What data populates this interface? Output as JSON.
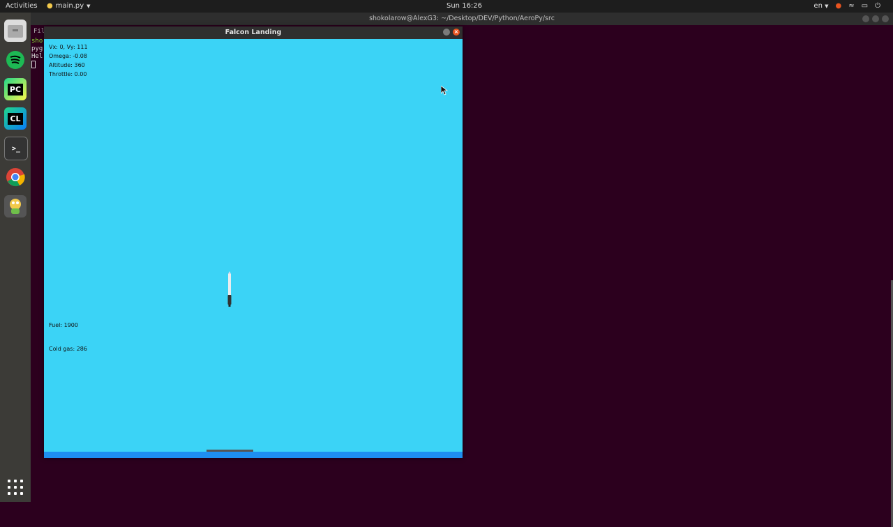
{
  "topbar": {
    "activities": "Activities",
    "app_name": "main.py",
    "clock": "Sun 16:26",
    "lang": "en"
  },
  "dock": {
    "items": [
      {
        "name": "files",
        "label": ""
      },
      {
        "name": "spotify",
        "label": ""
      },
      {
        "name": "pycharm",
        "label": "PC"
      },
      {
        "name": "clion",
        "label": "CL"
      },
      {
        "name": "terminal",
        "label": ">_"
      },
      {
        "name": "chrome",
        "label": ""
      },
      {
        "name": "pygame",
        "label": ""
      }
    ]
  },
  "terminal": {
    "title": "shokolarow@AlexG3: ~/Desktop/DEV/Python/AeroPy/src",
    "menu_file": "File",
    "line1": "sho",
    "line2": "pyg",
    "line3": "Hel"
  },
  "game_window": {
    "title": "Falcon Landing",
    "hud": {
      "velocity": "Vx: 0, Vy: 111",
      "omega": "Omega: -0.08",
      "altitude": "Altitude: 360",
      "throttle": "Throttle: 0.00",
      "fuel": "Fuel: 1900",
      "cold_gas": "Cold gas: 286"
    }
  },
  "colors": {
    "sky": "#3bd3f6",
    "ground": "#1e8ff0",
    "desktop": "#2c001e",
    "close": "#e9541f"
  }
}
